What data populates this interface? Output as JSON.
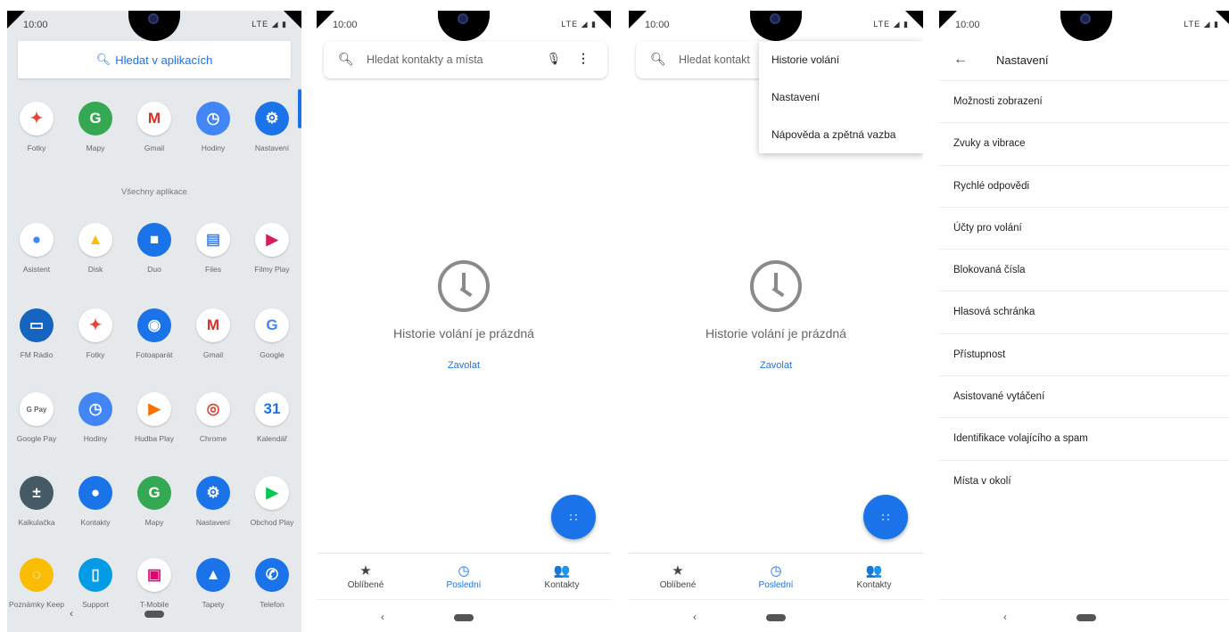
{
  "status": {
    "time": "10:00",
    "icons": "LTE ◢ ▮"
  },
  "screen1": {
    "search_label": "Hledat v aplikacích",
    "section_title": "Všechny aplikace",
    "favorites": [
      {
        "label": "Fotky",
        "icon": "photos-icon",
        "bg": "#ffffff",
        "fg": "#ea4335",
        "glyph": "✦"
      },
      {
        "label": "Mapy",
        "icon": "maps-icon",
        "bg": "#34a853",
        "fg": "#ffffff",
        "glyph": "G"
      },
      {
        "label": "Gmail",
        "icon": "gmail-icon",
        "bg": "#ffffff",
        "fg": "#d93025",
        "glyph": "M"
      },
      {
        "label": "Hodiny",
        "icon": "clock-icon",
        "bg": "#4285f4",
        "fg": "#ffffff",
        "glyph": "◷"
      },
      {
        "label": "Nastavení",
        "icon": "settings-icon",
        "bg": "#1a73e8",
        "fg": "#ffffff",
        "glyph": "⚙"
      }
    ],
    "rows": [
      [
        {
          "label": "Asistent",
          "icon": "assistant-icon",
          "bg": "#ffffff",
          "fg": "#4285f4",
          "glyph": "●"
        },
        {
          "label": "Disk",
          "icon": "drive-icon",
          "bg": "#ffffff",
          "fg": "#fbbc04",
          "glyph": "▲"
        },
        {
          "label": "Duo",
          "icon": "duo-icon",
          "bg": "#1a73e8",
          "fg": "#ffffff",
          "glyph": "■"
        },
        {
          "label": "Files",
          "icon": "files-icon",
          "bg": "#ffffff",
          "fg": "#4285f4",
          "glyph": "▤"
        },
        {
          "label": "Filmy Play",
          "icon": "play-movies-icon",
          "bg": "#ffffff",
          "fg": "#d81b60",
          "glyph": "▶"
        }
      ],
      [
        {
          "label": "FM Rádio",
          "icon": "radio-icon",
          "bg": "#1565c0",
          "fg": "#ffffff",
          "glyph": "▭"
        },
        {
          "label": "Fotky",
          "icon": "photos-icon",
          "bg": "#ffffff",
          "fg": "#ea4335",
          "glyph": "✦"
        },
        {
          "label": "Fotoaparát",
          "icon": "camera-icon",
          "bg": "#1a73e8",
          "fg": "#ffffff",
          "glyph": "◉"
        },
        {
          "label": "Gmail",
          "icon": "gmail-icon",
          "bg": "#ffffff",
          "fg": "#d93025",
          "glyph": "M"
        },
        {
          "label": "Google",
          "icon": "google-icon",
          "bg": "#ffffff",
          "fg": "#4285f4",
          "glyph": "G"
        }
      ],
      [
        {
          "label": "Google Pay",
          "icon": "google-pay-icon",
          "bg": "#ffffff",
          "fg": "#5f6368",
          "glyph": "G Pay"
        },
        {
          "label": "Hodiny",
          "icon": "clock-icon",
          "bg": "#4285f4",
          "fg": "#ffffff",
          "glyph": "◷"
        },
        {
          "label": "Hudba Play",
          "icon": "play-music-icon",
          "bg": "#ffffff",
          "fg": "#ff6d00",
          "glyph": "▶"
        },
        {
          "label": "Chrome",
          "icon": "chrome-icon",
          "bg": "#ffffff",
          "fg": "#db4437",
          "glyph": "◎"
        },
        {
          "label": "Kalendář",
          "icon": "calendar-icon",
          "bg": "#ffffff",
          "fg": "#1a73e8",
          "glyph": "31"
        }
      ],
      [
        {
          "label": "Kalkulačka",
          "icon": "calculator-icon",
          "bg": "#455a64",
          "fg": "#ffffff",
          "glyph": "±"
        },
        {
          "label": "Kontakty",
          "icon": "contacts-icon",
          "bg": "#1a73e8",
          "fg": "#ffffff",
          "glyph": "●"
        },
        {
          "label": "Mapy",
          "icon": "maps-icon",
          "bg": "#34a853",
          "fg": "#ffffff",
          "glyph": "G"
        },
        {
          "label": "Nastavení",
          "icon": "settings-icon",
          "bg": "#1a73e8",
          "fg": "#ffffff",
          "glyph": "⚙"
        },
        {
          "label": "Obchod Play",
          "icon": "play-store-icon",
          "bg": "#ffffff",
          "fg": "#00c853",
          "glyph": "▶"
        }
      ],
      [
        {
          "label": "Poznámky Keep",
          "icon": "keep-icon",
          "bg": "#fbbc04",
          "fg": "#ffffff",
          "glyph": "◌"
        },
        {
          "label": "Support",
          "icon": "support-icon",
          "bg": "#039be5",
          "fg": "#ffffff",
          "glyph": "▯"
        },
        {
          "label": "T-Mobile",
          "icon": "tmobile-icon",
          "bg": "#ffffff",
          "fg": "#e20074",
          "glyph": "▣"
        },
        {
          "label": "Tapety",
          "icon": "wallpapers-icon",
          "bg": "#1a73e8",
          "fg": "#ffffff",
          "glyph": "▲"
        },
        {
          "label": "Telefon",
          "icon": "phone-icon",
          "bg": "#1a73e8",
          "fg": "#ffffff",
          "glyph": "✆"
        }
      ]
    ]
  },
  "dialer": {
    "search_placeholder": "Hledat kontakty a místa",
    "search_placeholder_truncated": "Hledat kontakt",
    "empty_text": "Historie volání je prázdná",
    "call_link": "Zavolat",
    "tabs": [
      {
        "label": "Oblíbené",
        "glyph": "★",
        "icon": "star-icon"
      },
      {
        "label": "Poslední",
        "glyph": "◷",
        "icon": "recent-icon"
      },
      {
        "label": "Kontakty",
        "glyph": "👥",
        "icon": "contacts-tab-icon"
      }
    ],
    "menu": [
      "Historie volání",
      "Nastavení",
      "Nápověda a zpětná vazba"
    ]
  },
  "settings": {
    "title": "Nastavení",
    "items": [
      "Možnosti zobrazení",
      "Zvuky a vibrace",
      "Rychlé odpovědi",
      "Účty pro volání",
      "Blokovaná čísla",
      "Hlasová schránka",
      "Přístupnost",
      "Asistované vytáčení",
      "Identifikace volajícího a spam",
      "Místa v okolí"
    ]
  }
}
